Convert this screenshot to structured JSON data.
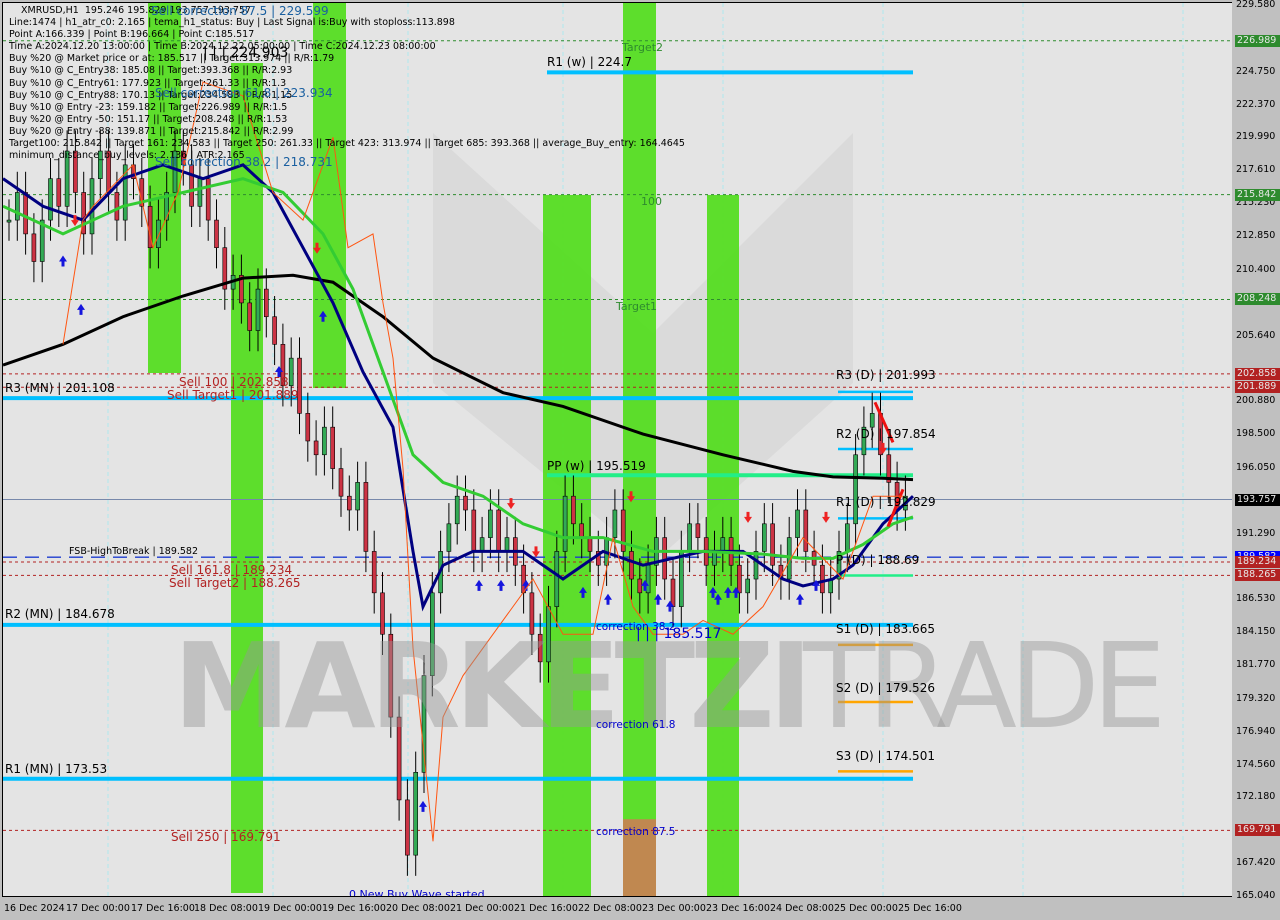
{
  "symbol": "XMRUSD,H1",
  "ohlc": "195.246 195.829 193.757 193.757",
  "info_lines": [
    "Line:1474 | h1_atr_c0: 2.165 | tema_h1_status: Buy | Last Signal is:Buy with stoploss:113.898",
    "Point A:166.339 | Point B:196.664 | Point C:185.517",
    "Time A:2024.12.20 13:00:00 | Time B:2024.12.22 05:00:00 | Time C:2024.12.23 08:00:00",
    "Buy %20 @ Market price or at: 185.517 || Target:313.974 || R/R:1.79",
    "Buy %10 @ C_Entry38: 185.08 || Target:393.368 || R/R:2.93",
    "Buy %10 @ C_Entry61: 177.923 || Target:261.33 || R/R:1.3",
    "Buy %10 @ C_Entry88: 170.13 || Target:234.583 || R/R:1.15",
    "Buy %10 @ Entry -23: 159.182 || Target:226.989 || R/R:1.5",
    "Buy %20 @ Entry -50: 151.17 || Target:208.248 || R/R:1.53",
    "Buy %20 @ Entry -88: 139.871 || Target:215.842 || R/R:2.99",
    "Target100: 215.842 || Target 161: 234.583 || Target 250: 261.33 || Target 423: 313.974 || Target 685: 393.368 || average_Buy_entry: 164.4645",
    "minimum_distance_buy_levels: 2.136 | ATR:2.165"
  ],
  "overlay_labels": {
    "sell_corr_875": "Sell correction 87.5 | 229.599",
    "sell_corr_618": "Sell correction 61.8 | 223.934",
    "sell_corr_382": "Sell correction 38.2 | 218.731",
    "high_label": "| | | 224.903",
    "low_label": "| | | 185.517",
    "new_wave": "0 New Buy Wave started",
    "target1": "Target1",
    "target2": "Target2",
    "level_100": "100",
    "correction_382": "correction 38.2",
    "correction_618": "correction 61.8",
    "correction_875": "correction 87.5"
  },
  "levels": {
    "r1_w": "R1 (w) | 224.7",
    "pp_w": "PP (w) | 195.519",
    "r3_mn": "R3 (MN) | 201.108",
    "r2_mn": "R2 (MN) | 184.678",
    "r1_mn": "R1 (MN) | 173.53",
    "r3_d": "R3 (D) | 201.993",
    "r2_d": "R2 (D) | 197.854",
    "r1_d": "R1 (D) | 192.829",
    "p_d": "P (D) | 188.69",
    "s1_d": "S1 (D) | 183.665",
    "s2_d": "S2 (D) | 179.526",
    "s3_d": "S3 (D) | 174.501",
    "fsb": "FSB-HighToBreak | 189.582",
    "sell_100": "Sell 100 | 202.858",
    "sell_target1": "Sell Target1 | 201.889",
    "sell_1618": "Sell 161.8 | 189.234",
    "sell_target2": "Sell Target2 | 188.265",
    "sell_250": "Sell  250 | 169.791"
  },
  "watermark": {
    "bold": "MARKETZI",
    "light": "TRADE"
  },
  "y_axis": {
    "ticks": [
      "229.580",
      "224.750",
      "222.370",
      "219.990",
      "217.610",
      "215.230",
      "212.850",
      "210.400",
      "205.640",
      "200.880",
      "198.500",
      "196.050",
      "191.290",
      "186.530",
      "184.150",
      "181.770",
      "179.320",
      "176.940",
      "174.560",
      "172.180",
      "167.420",
      "165.040"
    ],
    "badges": [
      {
        "value": "226.989",
        "color": "#2e8b2e"
      },
      {
        "value": "215.842",
        "color": "#2e8b2e"
      },
      {
        "value": "208.248",
        "color": "#2e8b2e"
      },
      {
        "value": "202.858",
        "color": "#b22222"
      },
      {
        "value": "201.889",
        "color": "#b22222"
      },
      {
        "value": "193.757",
        "color": "#000000"
      },
      {
        "value": "189.582",
        "color": "#0000ff"
      },
      {
        "value": "189.234",
        "color": "#b22222"
      },
      {
        "value": "188.265",
        "color": "#b22222"
      },
      {
        "value": "169.791",
        "color": "#b22222"
      }
    ]
  },
  "x_axis": {
    "ticks": [
      "16 Dec 2024",
      "17 Dec 00:00",
      "17 Dec 16:00",
      "18 Dec 08:00",
      "19 Dec 00:00",
      "19 Dec 16:00",
      "20 Dec 08:00",
      "21 Dec 00:00",
      "21 Dec 16:00",
      "22 Dec 08:00",
      "23 Dec 00:00",
      "23 Dec 16:00",
      "24 Dec 08:00",
      "25 Dec 00:00",
      "25 Dec 16:00"
    ]
  },
  "colors": {
    "bg": "#e4e4e4",
    "green_zone": "#55dd22",
    "pivot_blue": "#00bfff",
    "pp_green": "#22ee88",
    "support_orange": "#ffa500",
    "sell_red": "#b22222",
    "ma_black": "#000000",
    "ma_navy": "#000080",
    "ma_green": "#33cc33"
  }
}
